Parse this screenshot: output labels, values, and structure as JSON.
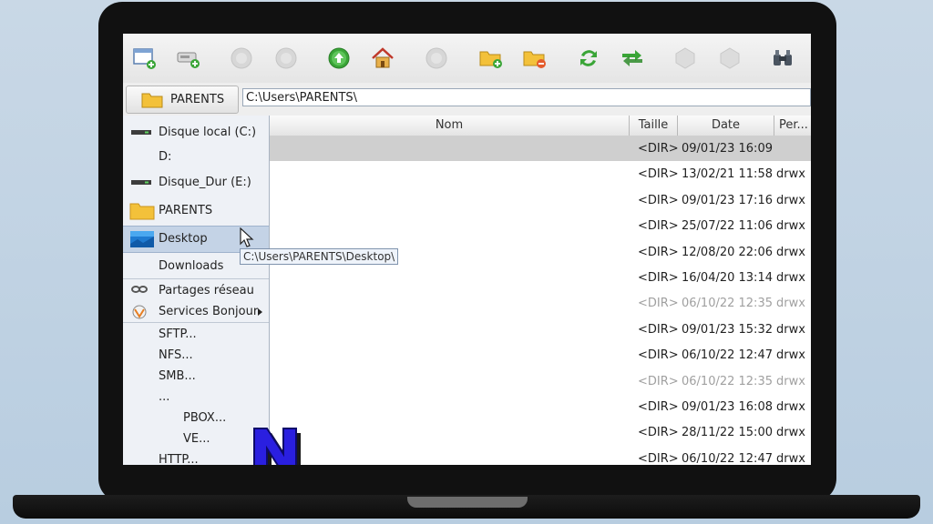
{
  "toolbar": {
    "buttons": [
      {
        "icon": "new-window-icon",
        "enabled": true
      },
      {
        "icon": "new-connection-icon",
        "enabled": true
      },
      {
        "icon": "back-icon",
        "enabled": false
      },
      {
        "icon": "forward-icon",
        "enabled": false
      },
      {
        "icon": "up-arrow-icon",
        "enabled": true
      },
      {
        "icon": "home-icon",
        "enabled": true
      },
      {
        "icon": "stop-icon",
        "enabled": false
      },
      {
        "icon": "new-folder-icon",
        "enabled": true
      },
      {
        "icon": "delete-folder-icon",
        "enabled": true
      },
      {
        "icon": "refresh-icon",
        "enabled": true
      },
      {
        "icon": "swap-icon",
        "enabled": true
      },
      {
        "icon": "disabled-a-icon",
        "enabled": false
      },
      {
        "icon": "disabled-b-icon",
        "enabled": false
      },
      {
        "icon": "binoculars-icon",
        "enabled": true
      }
    ]
  },
  "pathbar": {
    "location_button": "PARENTS",
    "path": "C:\\Users\\PARENTS\\"
  },
  "sidebar": {
    "items": [
      {
        "label": "Disque local (C:)",
        "icon": "drive-icon"
      },
      {
        "label": "D:",
        "icon": "none"
      },
      {
        "label": "Disque_Dur (E:)",
        "icon": "drive-icon"
      },
      {
        "label": "PARENTS",
        "icon": "folder-icon"
      },
      {
        "label": "Desktop",
        "icon": "desktop-icon",
        "selected": true
      },
      {
        "label": "Downloads",
        "icon": "none"
      },
      {
        "label": "Partages réseau",
        "icon": "network-icon"
      },
      {
        "label": "Services Bonjour",
        "icon": "bonjour-icon",
        "submenu": true
      },
      {
        "label": "SFTP...",
        "icon": "none"
      },
      {
        "label": "NFS...",
        "icon": "none"
      },
      {
        "label": "SMB...",
        "icon": "none"
      },
      {
        "label": "...",
        "icon": "none"
      },
      {
        "label": "PBOX...",
        "icon": "none"
      },
      {
        "label": "VE...",
        "icon": "none"
      },
      {
        "label": "HTTP...",
        "icon": "none"
      }
    ]
  },
  "table": {
    "columns": [
      "Nom",
      "Taille",
      "Date",
      "Per..."
    ],
    "rows": [
      {
        "name": "",
        "size": "<DIR>",
        "date": "09/01/23 16:09",
        "perm": "",
        "selected": true
      },
      {
        "name": "",
        "size": "<DIR>",
        "date": "13/02/21 11:58",
        "perm": "drwx"
      },
      {
        "name": "",
        "size": "<DIR>",
        "date": "09/01/23 17:16",
        "perm": "drwx"
      },
      {
        "name": "",
        "size": "<DIR>",
        "date": "25/07/22 11:06",
        "perm": "drwx"
      },
      {
        "name": "",
        "size": "<DIR>",
        "date": "12/08/20 22:06",
        "perm": "drwx"
      },
      {
        "name": "",
        "size": "<DIR>",
        "date": "16/04/20 13:14",
        "perm": "drwx"
      },
      {
        "name": "",
        "size": "<DIR>",
        "date": "06/10/22 12:35",
        "perm": "drwx",
        "dim": true
      },
      {
        "name": "",
        "size": "<DIR>",
        "date": "09/01/23 15:32",
        "perm": "drwx"
      },
      {
        "name": "",
        "size": "<DIR>",
        "date": "06/10/22 12:47",
        "perm": "drwx"
      },
      {
        "name": "",
        "size": "<DIR>",
        "date": "06/10/22 12:35",
        "perm": "drwx",
        "dim": true
      },
      {
        "name": "",
        "size": "<DIR>",
        "date": "09/01/23 16:08",
        "perm": "drwx"
      },
      {
        "name": "",
        "size": "<DIR>",
        "date": "28/11/22 15:00",
        "perm": "drwx"
      },
      {
        "name": "",
        "size": "<DIR>",
        "date": "06/10/22 12:47",
        "perm": "drwx"
      }
    ]
  },
  "tooltip": "C:\\Users\\PARENTS\\Desktop\\",
  "colors": {
    "selection": "#c4d3e6",
    "row_selected": "#cfcfcf",
    "accent_green": "#3aa537",
    "folder_yellow": "#f3c13a",
    "logo_blue": "#2a1fe0"
  }
}
